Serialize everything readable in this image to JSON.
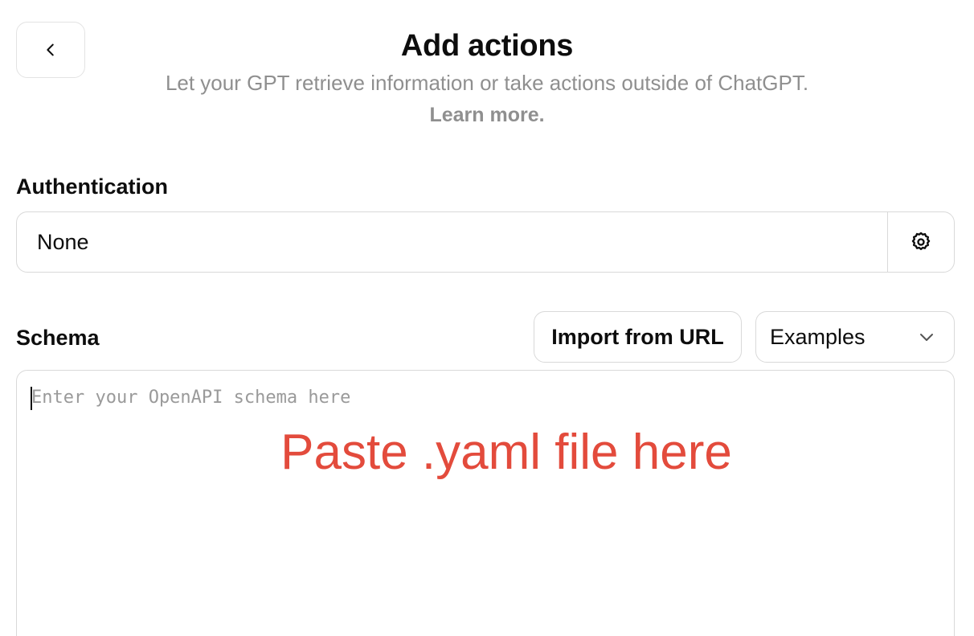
{
  "header": {
    "title": "Add actions",
    "subtitle": "Let your GPT retrieve information or take actions outside of ChatGPT.",
    "learn_more": "Learn more."
  },
  "icons": {
    "back": "chevron-left-icon",
    "settings": "gear-icon",
    "dropdown": "chevron-down-icon"
  },
  "authentication": {
    "label": "Authentication",
    "value": "None"
  },
  "schema": {
    "label": "Schema",
    "import_label": "Import from URL",
    "examples_label": "Examples",
    "placeholder": "Enter your OpenAPI schema here",
    "value": ""
  },
  "annotation": {
    "text": "Paste .yaml file here",
    "color": "#e34b3c"
  }
}
